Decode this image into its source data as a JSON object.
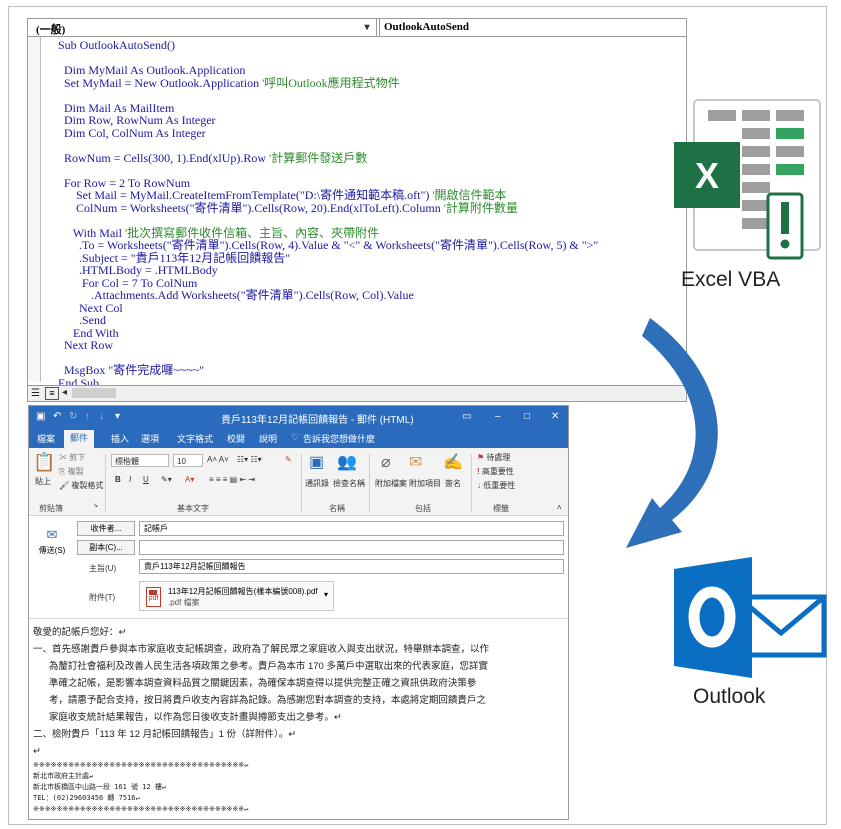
{
  "vba_editor": {
    "object_combo": "(一般)",
    "procedure_combo": "OutlookAutoSend",
    "code_lines": [
      {
        "code": "Sub OutlookAutoSend()",
        "comment": ""
      },
      {
        "code": "",
        "comment": ""
      },
      {
        "code": "  Dim MyMail As Outlook.Application",
        "comment": ""
      },
      {
        "code": "  Set MyMail = New Outlook.Application ",
        "comment": "'呼叫Outlook應用程式物件"
      },
      {
        "code": "",
        "comment": ""
      },
      {
        "code": "  Dim Mail As MailItem",
        "comment": ""
      },
      {
        "code": "  Dim Row, RowNum As Integer",
        "comment": ""
      },
      {
        "code": "  Dim Col, ColNum As Integer",
        "comment": ""
      },
      {
        "code": "",
        "comment": ""
      },
      {
        "code": "  RowNum = Cells(300, 1).End(xlUp).Row ",
        "comment": "'計算郵件發送戶數"
      },
      {
        "code": "",
        "comment": ""
      },
      {
        "code": "  For Row = 2 To RowNum",
        "comment": ""
      },
      {
        "code": "      Set Mail = MyMail.CreateItemFromTemplate(\"D:\\寄件通知範本稿.oft\") ",
        "comment": "'開啟信件範本"
      },
      {
        "code": "      ColNum = Worksheets(\"寄件清單\").Cells(Row, 20).End(xlToLeft).Column ",
        "comment": "'計算附件數量"
      },
      {
        "code": "",
        "comment": ""
      },
      {
        "code": "     With Mail ",
        "comment": "'批次撰寫郵件收件信箱、主旨、內容、夾帶附件"
      },
      {
        "code": "       .To = Worksheets(\"寄件清單\").Cells(Row, 4).Value & \"<\" & Worksheets(\"寄件清單\").Cells(Row, 5) & \">\"",
        "comment": ""
      },
      {
        "code": "       .Subject = \"貴戶113年12月記帳回饋報告\"",
        "comment": ""
      },
      {
        "code": "       .HTMLBody = .HTMLBody",
        "comment": ""
      },
      {
        "code": "        For Col = 7 To ColNum",
        "comment": ""
      },
      {
        "code": "           .Attachments.Add Worksheets(\"寄件清單\").Cells(Row, Col).Value",
        "comment": ""
      },
      {
        "code": "       Next Col",
        "comment": ""
      },
      {
        "code": "       .Send",
        "comment": ""
      },
      {
        "code": "     End With",
        "comment": ""
      },
      {
        "code": "  Next Row",
        "comment": ""
      },
      {
        "code": "",
        "comment": ""
      },
      {
        "code": "  MsgBox \"寄件完成囉~~~~\"",
        "comment": ""
      },
      {
        "code": "End Sub",
        "comment": ""
      }
    ]
  },
  "outlook_window": {
    "title": "貴戶113年12月記帳回饋報告 - 郵件 (HTML)",
    "tabs": [
      "檔案",
      "郵件",
      "插入",
      "選項",
      "文字格式",
      "校閱",
      "說明"
    ],
    "tell_me": "告訴我您想做什麼",
    "ribbon": {
      "cut": "剪下",
      "copy": "複製",
      "paste": "貼上",
      "format_painter": "複製格式",
      "font_name": "標楷體",
      "font_size": "10",
      "address_book": "通訊錄",
      "check_names": "檢查名稱",
      "attach_file": "附加檔案",
      "attach_item": "附加項目",
      "signature": "簽名",
      "follow_up": "待處理",
      "high_importance": "高重要性",
      "low_importance": "低重要性",
      "groups": [
        "剪貼簿",
        "基本文字",
        "名稱",
        "包括",
        "標籤"
      ]
    },
    "header": {
      "send": "傳送(S)",
      "from_button": "收件者...",
      "to_value": "記帳戶",
      "cc_button": "副本(C)...",
      "cc_value": "",
      "subject_label": "主旨(U)",
      "subject_value": "貴戶113年12月記帳回饋報告",
      "attach_label": "附件(T)",
      "attachment_name": "113年12月記帳回饋報告(樣本編號008).pdf",
      "attachment_size": ".pdf 檔案"
    },
    "body": [
      "敬愛的記帳戶您好：↵",
      "一、首先感謝貴戶參與本市家庭收支記帳調查，政府為了解民眾之家庭收入與支出狀況，特舉辦本調查，以作",
      "      為釐訂社會福利及改善人民生活各項政策之參考。貴戶為本市 170 多萬戶中選取出來的代表家庭，您詳實",
      "      準確之記帳，是影響本調查資料品質之關鍵因素，為確保本調查得以提供完整正確之資訊供政府決策參",
      "      考，請惠予配合支持，按日將貴戶收支內容詳為記錄。為感謝您對本調查的支持，本處將定期回饋貴戶之",
      "      家庭收支統計結果報告，以作為您日後收支計畫與撙節支出之參考。↵",
      "二、檢附貴戶「113 年 12 月記帳回饋報告」1 份（詳附件）。↵",
      "↵"
    ],
    "signature": [
      "※※※※※※※※※※※※※※※※※※※※※※※※※※※※※※※※※※※※↵",
      "新北市政府主計處↵",
      "新北市板橋區中山路一段 161 號 12 樓↵",
      "TEL：(02)29603456 轉 7516↵",
      "※※※※※※※※※※※※※※※※※※※※※※※※※※※※※※※※※※※※↵"
    ]
  },
  "labels": {
    "excel": "Excel VBA",
    "outlook": "Outlook"
  },
  "colors": {
    "excel_green": "#1e7145",
    "outlook_blue": "#0a6fc2",
    "arrow_blue": "#2e6fba",
    "vba_keyword": "#1a1aa0",
    "vba_comment": "#2e8b2e"
  }
}
